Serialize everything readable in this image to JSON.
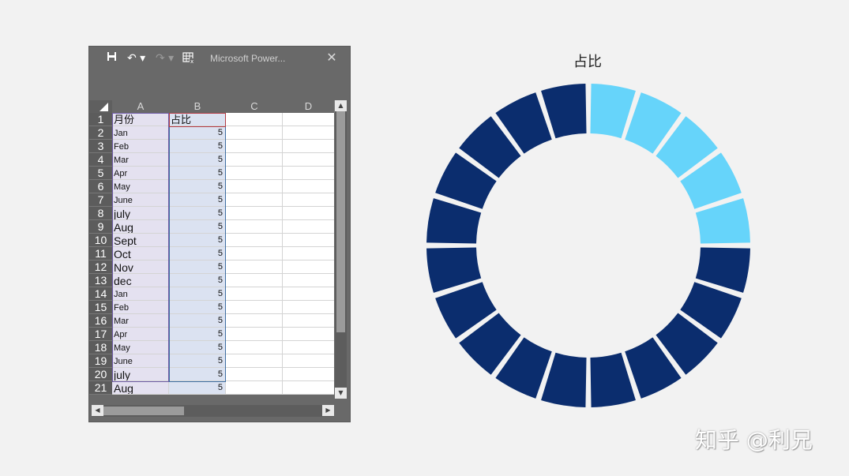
{
  "window": {
    "title": "Microsoft Power...",
    "icons": [
      "save-icon",
      "undo-icon",
      "redo-icon",
      "table-icon",
      "close-icon"
    ],
    "undo_label": "↶ ▾",
    "redo_label": "↷ ▾",
    "close_label": "✕"
  },
  "sheet": {
    "columns": [
      "A",
      "B",
      "C",
      "D"
    ],
    "header_row": {
      "a": "月份",
      "b": "占比"
    },
    "rows": [
      {
        "n": "2",
        "a": "Jan",
        "b": "5"
      },
      {
        "n": "3",
        "a": "Feb",
        "b": "5"
      },
      {
        "n": "4",
        "a": "Mar",
        "b": "5"
      },
      {
        "n": "5",
        "a": "Apr",
        "b": "5"
      },
      {
        "n": "6",
        "a": "May",
        "b": "5"
      },
      {
        "n": "7",
        "a": " June",
        "b": "5"
      },
      {
        "n": "8",
        "a": "july",
        "b": "5"
      },
      {
        "n": "9",
        "a": "Aug",
        "b": "5"
      },
      {
        "n": "10",
        "a": "Sept",
        "b": "5"
      },
      {
        "n": "11",
        "a": "Oct",
        "b": "5"
      },
      {
        "n": "12",
        "a": "Nov",
        "b": "5"
      },
      {
        "n": "13",
        "a": "dec",
        "b": "5"
      },
      {
        "n": "14",
        "a": "Jan",
        "b": "5"
      },
      {
        "n": "15",
        "a": "Feb",
        "b": "5"
      },
      {
        "n": "16",
        "a": "Mar",
        "b": "5"
      },
      {
        "n": "17",
        "a": "Apr",
        "b": "5"
      },
      {
        "n": "18",
        "a": "May",
        "b": "5"
      },
      {
        "n": "19",
        "a": " June",
        "b": "5"
      },
      {
        "n": "20",
        "a": "july",
        "b": "5"
      },
      {
        "n": "21",
        "a": "Aug",
        "b": "5"
      }
    ]
  },
  "chart_data": {
    "type": "pie",
    "subtype": "doughnut",
    "title": "占比",
    "categories": [
      "Jan",
      "Feb",
      "Mar",
      "Apr",
      "May",
      " June",
      "july",
      "Aug",
      "Sept",
      "Oct",
      "Nov",
      "dec",
      "Jan",
      "Feb",
      "Mar",
      "Apr",
      "May",
      " June",
      "july",
      "Aug"
    ],
    "values": [
      5,
      5,
      5,
      5,
      5,
      5,
      5,
      5,
      5,
      5,
      5,
      5,
      5,
      5,
      5,
      5,
      5,
      5,
      5,
      5
    ],
    "highlighted_count": 5,
    "colors": {
      "highlight": "#66d4fa",
      "base": "#0b2d6e"
    },
    "legend": "none"
  },
  "watermark": "知乎 @利兄"
}
